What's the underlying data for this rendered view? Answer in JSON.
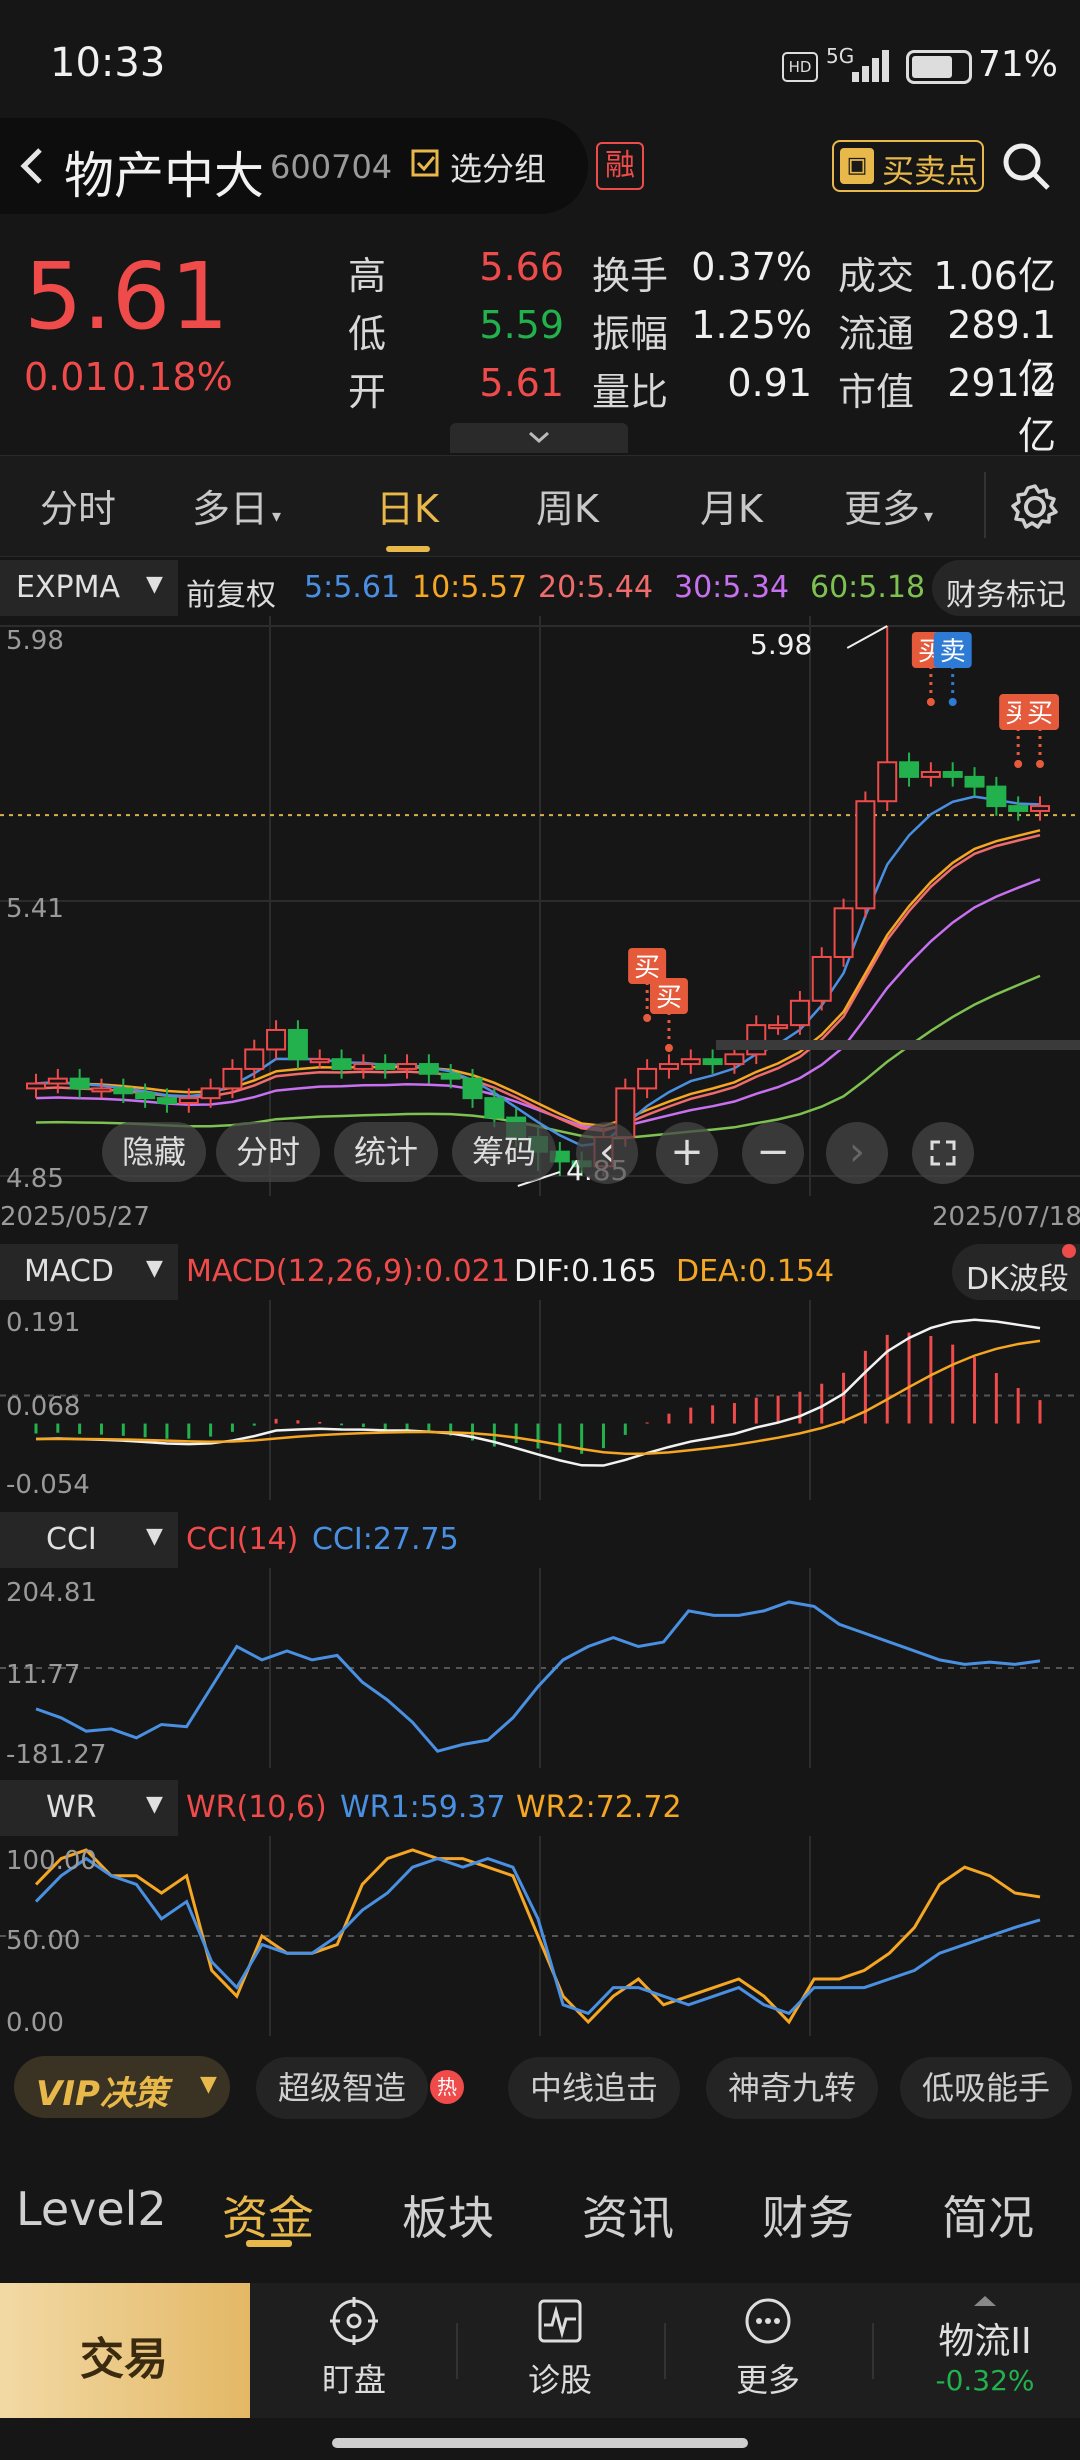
{
  "status": {
    "time": "10:33",
    "battery": "71%",
    "net": "5G"
  },
  "header": {
    "stock_name": "物产中大",
    "code": "600704",
    "group_label": "选分组",
    "margin_badge": "融",
    "bs_label": "买卖点"
  },
  "quote": {
    "price": "5.61",
    "change": "0.01",
    "change_pct": "0.18%",
    "rows": [
      {
        "l1": "高",
        "v1": "5.66",
        "c1": "red",
        "l2": "换手",
        "v2": "0.37%",
        "l3": "成交",
        "v3": "1.06亿"
      },
      {
        "l1": "低",
        "v1": "5.59",
        "c1": "green",
        "l2": "振幅",
        "v2": "1.25%",
        "l3": "流通",
        "v3": "289.1亿"
      },
      {
        "l1": "开",
        "v1": "5.61",
        "c1": "red",
        "l2": "量比",
        "v2": "0.91",
        "l3": "市值",
        "v3": "291.2亿"
      }
    ]
  },
  "tabs": [
    "分时",
    "多日",
    "日K",
    "周K",
    "月K",
    "更多"
  ],
  "active_tab": "日K",
  "expma": {
    "name": "EXPMA",
    "adjust": "前复权",
    "items": [
      {
        "label": "5:5.61",
        "color": "#4a90e2"
      },
      {
        "label": "10:5.57",
        "color": "#f5a623"
      },
      {
        "label": "20:5.44",
        "color": "#f06b6b"
      },
      {
        "label": "30:5.34",
        "color": "#c770f0"
      },
      {
        "label": "60:5.18",
        "color": "#7dc150"
      }
    ],
    "finance_mark": "财务标记",
    "y_top": "5.98",
    "y_mid": "5.41",
    "y_bot": "4.85",
    "high_label": "5.98",
    "low_label": "4.85",
    "date_start": "2025/05/27",
    "date_end": "2025/07/18",
    "buy": "买",
    "sell": "卖",
    "overlay_buttons": [
      "隐藏",
      "分时",
      "统计",
      "筹码"
    ]
  },
  "macd": {
    "name": "MACD",
    "params": "MACD(12,26,9):0.021",
    "dif": "DIF:0.165",
    "dea": "DEA:0.154",
    "dk": "DK波段",
    "y_top": "0.191",
    "y_mid": "0.068",
    "y_bot": "-0.054"
  },
  "cci": {
    "name": "CCI",
    "params": "CCI(14)",
    "value": "CCI:27.75",
    "y_top": "204.81",
    "y_mid": "11.77",
    "y_bot": "-181.27"
  },
  "wr": {
    "name": "WR",
    "params": "WR(10,6)",
    "wr1": "WR1:59.37",
    "wr2": "WR2:72.72",
    "y_top": "100.00",
    "y_mid": "50.00",
    "y_bot": "0.00"
  },
  "strategy": {
    "vip": "VIP决策",
    "chips": [
      "超级智造",
      "中线追击",
      "神奇九转",
      "低吸能手"
    ],
    "hot": "热"
  },
  "bottom_tabs": [
    "Level2",
    "资金",
    "板块",
    "资讯",
    "财务",
    "简况"
  ],
  "active_bottom_tab": "资金",
  "bottom_bar": {
    "trade": "交易",
    "items": [
      "盯盘",
      "诊股",
      "更多"
    ],
    "sector": "物流II",
    "sector_change": "-0.32%"
  },
  "chart_data": [
    {
      "type": "candlestick",
      "title": "EXPMA",
      "x_range": [
        "2025/05/27",
        "2025/07/18"
      ],
      "ylim": [
        4.85,
        5.98
      ],
      "series": [
        {
          "name": "EXPMA5",
          "last": 5.61
        },
        {
          "name": "EXPMA10",
          "last": 5.57
        },
        {
          "name": "EXPMA20",
          "last": 5.44
        },
        {
          "name": "EXPMA30",
          "last": 5.34
        },
        {
          "name": "EXPMA60",
          "last": 5.18
        }
      ],
      "close": [
        5.04,
        5.05,
        5.03,
        5.03,
        5.02,
        5.01,
        5.0,
        5.01,
        5.03,
        5.07,
        5.11,
        5.15,
        5.09,
        5.09,
        5.07,
        5.08,
        5.07,
        5.08,
        5.06,
        5.05,
        5.01,
        4.97,
        4.93,
        4.9,
        4.88,
        4.87,
        4.93,
        5.03,
        5.07,
        5.08,
        5.09,
        5.08,
        5.1,
        5.16,
        5.16,
        5.21,
        5.3,
        5.4,
        5.62,
        5.7,
        5.67,
        5.68,
        5.67,
        5.65,
        5.61,
        5.6,
        5.61
      ]
    },
    {
      "type": "line",
      "title": "MACD",
      "ylim": [
        -0.054,
        0.191
      ],
      "series": [
        {
          "name": "DIF",
          "last": 0.165
        },
        {
          "name": "DEA",
          "last": 0.154
        },
        {
          "name": "MACD",
          "last": 0.021
        }
      ]
    },
    {
      "type": "line",
      "title": "CCI",
      "ylim": [
        -181.27,
        204.81
      ],
      "series": [
        {
          "name": "CCI",
          "last": 27.75
        }
      ]
    },
    {
      "type": "line",
      "title": "WR",
      "ylim": [
        0,
        100
      ],
      "series": [
        {
          "name": "WR1",
          "last": 59.37
        },
        {
          "name": "WR2",
          "last": 72.72
        }
      ]
    }
  ],
  "colors": {
    "up": "#f04b4b",
    "down": "#22b14c",
    "accent": "#e8b94a"
  }
}
